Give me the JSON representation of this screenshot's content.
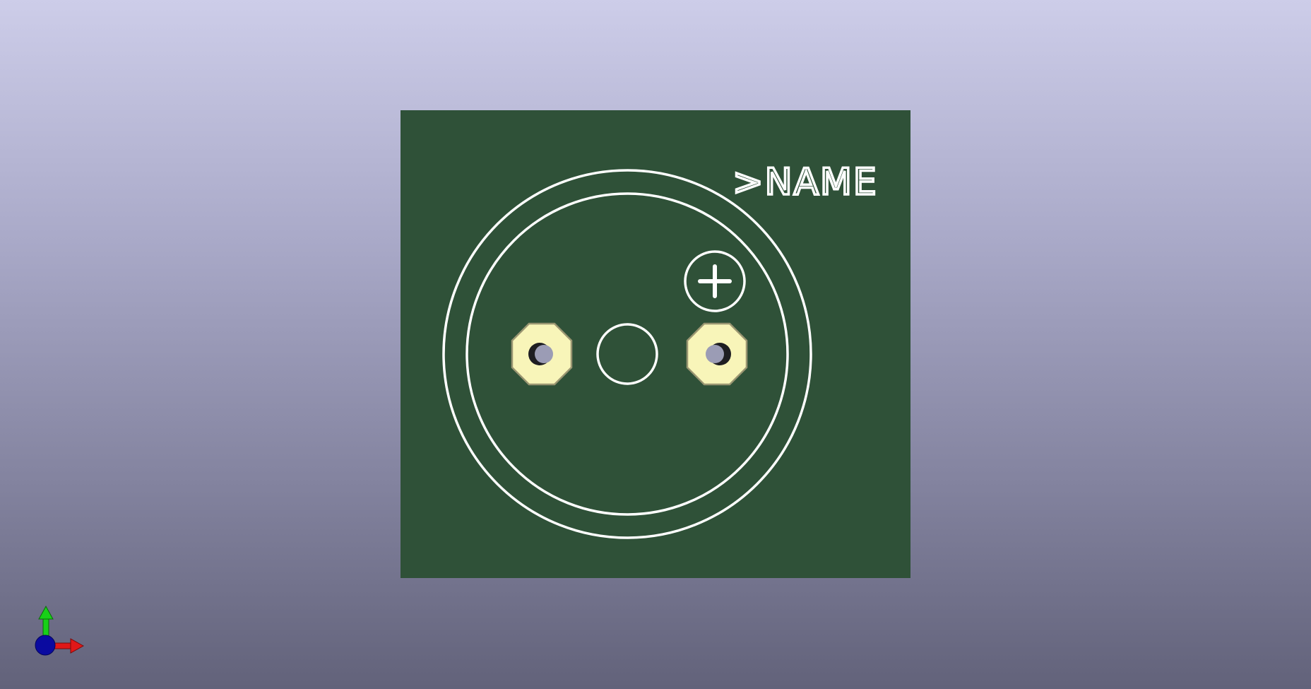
{
  "viewer": {
    "background_top": "#cdcde9",
    "background_bottom": "#62627a"
  },
  "board": {
    "substrate_color": "#2f5138",
    "silkscreen_color": "#ffffff",
    "pad_color": "#f8f5b9",
    "name_label": ">NAME",
    "polarity_marker": "+"
  },
  "axis_gizmo": {
    "x_color": "#e01818",
    "y_color": "#18d018",
    "z_color": "#0a0aa0"
  },
  "icons": {
    "axis": "xyz-axis-triad-icon"
  }
}
